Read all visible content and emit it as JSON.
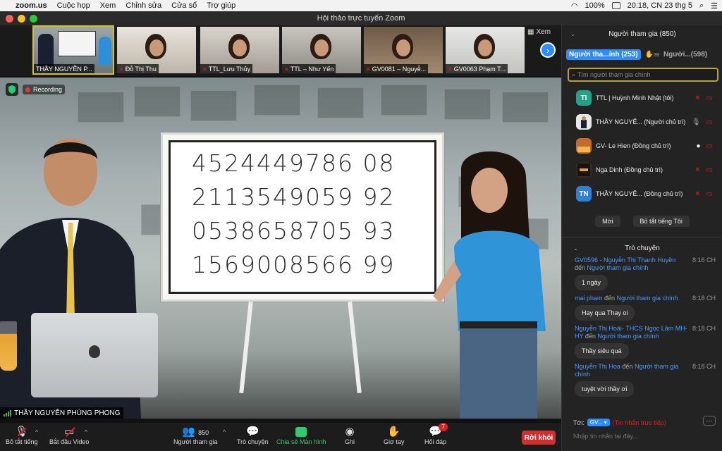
{
  "menubar": {
    "app": "zoom.us",
    "items": [
      "Cuộc họp",
      "Xem",
      "Chỉnh sửa",
      "Cửa sổ",
      "Trợ giúp"
    ],
    "battery": "100%",
    "datetime": "20:18, CN 23 thg 5"
  },
  "window": {
    "title": "Hội thảo trực tuyến Zoom"
  },
  "gallery": {
    "tiles": [
      {
        "name": "THẦY NGUYỄN P..."
      },
      {
        "name": "Đỗ Thị Thu"
      },
      {
        "name": "TTL_Lưu Thủy"
      },
      {
        "name": "TTL – Như Yến"
      },
      {
        "name": "GV0081 – Nguyễ..."
      },
      {
        "name": "GV0063 Phạm T..."
      }
    ],
    "view_label": "Xem"
  },
  "video": {
    "recording_label": "Recording",
    "speaker_label": "THẦY NGUYỄN PHÙNG PHONG",
    "board_rows": [
      "4524449786 08",
      "2113549059 92",
      "0538658705 93",
      "1569008566 99"
    ]
  },
  "toolbar": {
    "mute": "Bỏ tắt tiếng",
    "video": "Bắt đầu Video",
    "participants": "Người tham gia",
    "participants_count": "850",
    "chat": "Trò chuyện",
    "share": "Chia sẻ Màn hình",
    "record": "Ghi",
    "raise": "Giơ tay",
    "qa": "Hỏi đáp",
    "qa_badge": "7",
    "leave": "Rời khỏi"
  },
  "participants_panel": {
    "title": "Người tham gia (850)",
    "tab_main": "Người tha...ính (253)",
    "raise_count": "39",
    "tab_other": "Người...(598)",
    "search_placeholder": "Tìm người tham gia chính",
    "list": [
      {
        "initials": "TI",
        "name": "TTL | Huỳnh Minh Nhật (tôi)",
        "color": "#25a08a"
      },
      {
        "initials": "",
        "name": "THẦY NGUYỄ... (Người chủ trì)",
        "color": "#c9b48a"
      },
      {
        "initials": "",
        "name": "GV- Le Hien (Đồng chủ trì)",
        "color": "#c46b2a"
      },
      {
        "initials": "",
        "name": "Nga Dinh (Đồng chủ trì)",
        "color": "#3a2a1a"
      },
      {
        "initials": "TN",
        "name": "THẦY NGUYỄ... (Đồng chủ trì)",
        "color": "#2d7fd8"
      }
    ],
    "invite": "Mời",
    "unmute_me": "Bỏ tắt tiếng Tôi"
  },
  "chat_panel": {
    "title": "Trò chuyện",
    "messages": [
      {
        "sender": "GV0596 - Nguyễn Thị Thanh Huyền",
        "to": "đến",
        "target": "Người tham gia chính",
        "time": "8:16 CH",
        "text": "1 ngày"
      },
      {
        "sender": "mai pham",
        "to": "đến",
        "target": "Người tham gia chính",
        "time": "8:18 CH",
        "text": "Hay qua Thay oi"
      },
      {
        "sender": "Nguyễn Thị Hoài- THCS Ngọc Lâm MH-HY",
        "to": "đến",
        "target": "Người tham gia chính",
        "time": "8:18 CH",
        "text": "Thầy siêu quá"
      },
      {
        "sender": "Nguyễn Thị Hoa",
        "to": "đến",
        "target": "Người tham gia chính",
        "time": "8:18 CH",
        "text": "tuyệt vời thầy ơi"
      }
    ],
    "to_label": "Tới:",
    "to_value": "GV...",
    "private_label": "(Tin nhắn trực tiếp)",
    "input_placeholder": "Nhập tin nhắn tại đây..."
  }
}
